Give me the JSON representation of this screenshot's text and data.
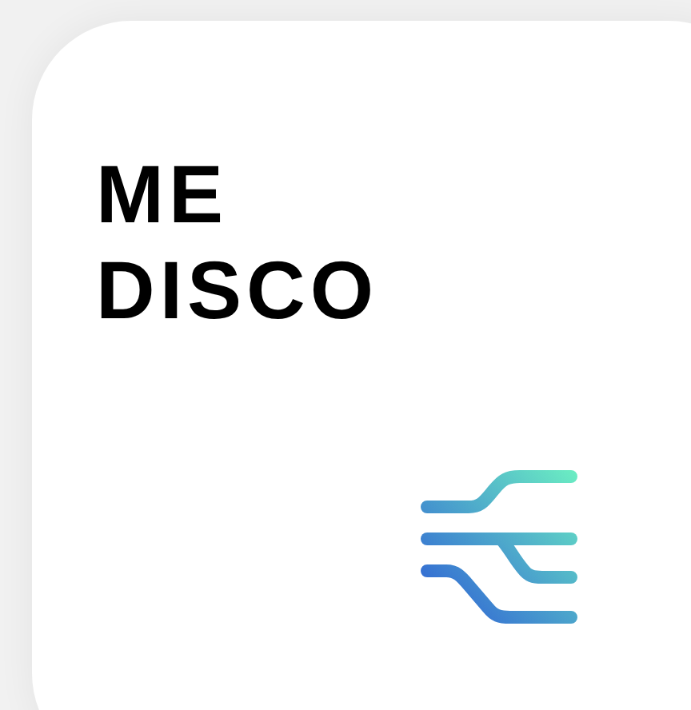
{
  "card": {
    "title": "ME DISCO"
  }
}
